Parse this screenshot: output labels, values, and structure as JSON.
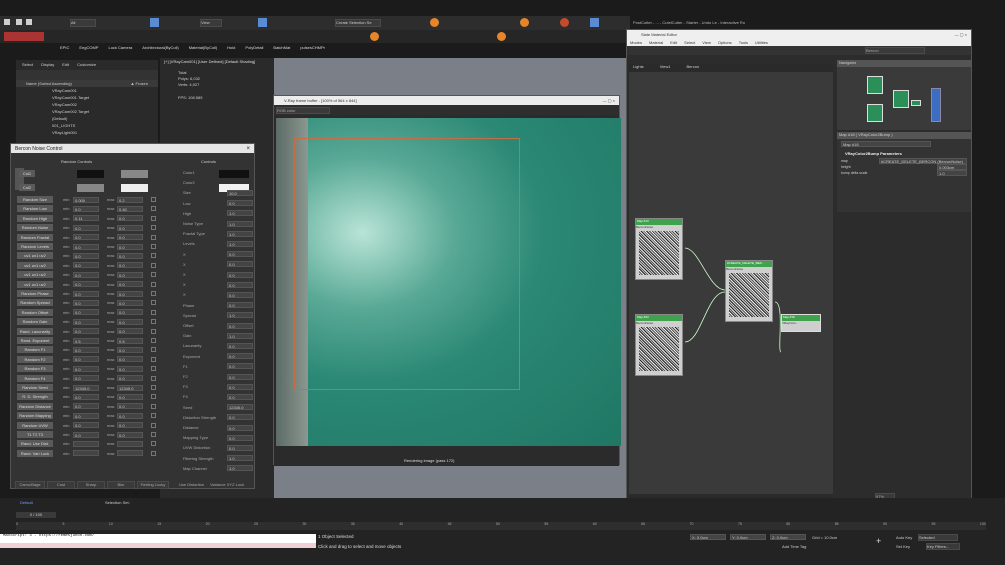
{
  "max": {
    "toolbar_dropdown": "All",
    "view_dropdown": "View",
    "selection_set": "Create Selection Se",
    "shelf": [
      "EPIC",
      "EngCOMP",
      "Lock Camera",
      "Architectural(ByColl)",
      "Material(ByColl)",
      "Hold",
      "PolyDetail",
      "BatchMat",
      "pulsesCHMPr"
    ],
    "scene_explorer": {
      "menu": [
        "Select",
        "Display",
        "Edit",
        "Customize"
      ],
      "header": "Name (Sorted Ascending)",
      "frozen_header": "▲ Frozen",
      "items": [
        "VRayCam001",
        "VRayCam001.Target",
        "VRayCam002",
        "VRayCam002.Target",
        "(Default)",
        "001_LIGHTS",
        "VRayLight001"
      ]
    },
    "viewport": {
      "label": "[+] [VRayCam001] [User Defined] [Default Shading]",
      "stats": [
        "Total",
        "Polys: 6,032",
        "Verts: 4,927"
      ],
      "fps": "FPS: 108.585"
    },
    "status": {
      "selected": "1 Object Selected",
      "hint": "Click and drag to select and move objects",
      "frame": "0 / 100",
      "workspace": "Default",
      "selection_set": "Selection Set:",
      "grid": "Grid = 10.0cm",
      "x": "X: 0.0cm",
      "y": "Y: 0.0cm",
      "z": "Z: 0.0cm",
      "add_time_tag": "Add Time Tag",
      "autokey": "Auto Key",
      "selected_dropdown": "Selected",
      "setkey": "Set Key",
      "keyfilters": "Key Filters...",
      "timeline_ticks": [
        "0",
        "5",
        "10",
        "15",
        "20",
        "25",
        "30",
        "35",
        "40",
        "45",
        "50",
        "55",
        "60",
        "65",
        "70",
        "75",
        "80",
        "85",
        "90",
        "95",
        "100"
      ]
    },
    "script": "MaxScript: 3 - https://remesjunon.com/"
  },
  "bercon": {
    "title": "Bercon Noise Control",
    "random_header": "Random Controls",
    "controls_header": "Controls",
    "color_labels": [
      "Col1",
      "Col2"
    ],
    "left_rows": [
      "Random Size",
      "Random Low",
      "Random High",
      "Random Noise",
      "Random Fractal",
      "Random Levels",
      "uv1 uv1 uv2",
      "uv1 uv1 uv2",
      "uv1 uv1 uv2",
      "uv1 uv1 uv2",
      "Random Phase",
      "Random Spread",
      "Random Offset",
      "Random Gain",
      "Rand. Lacunarity",
      "Rand. Exponent",
      "Random F1",
      "Random F2",
      "Random F3",
      "Random F4",
      "Random Seed",
      "R. D. Strength",
      "Random Distance",
      "Random Mapping",
      "Random UVW",
      "T1 T2 T3",
      "Rand. Use Dist.",
      "Rand. Vari Lock"
    ],
    "min_values": [
      "0.000",
      "0.0",
      "0.11",
      "0.0",
      "0.0",
      "0.0",
      "0.0",
      "0.0",
      "0.0",
      "0.0",
      "0.0",
      "0.0",
      "0.0",
      "0.0",
      "0.0",
      "0.5",
      "0.0",
      "0.0",
      "0.0",
      "0.0",
      "12345.0",
      "0.0",
      "0.0",
      "0.0",
      "0.0",
      "0.0",
      "",
      ""
    ],
    "max_values": [
      "0.2",
      "0.40",
      "0.0",
      "0.0",
      "0.0",
      "0.0",
      "0.0",
      "0.0",
      "0.0",
      "0.0",
      "0.0",
      "0.0",
      "0.0",
      "0.0",
      "0.0",
      "0.5",
      "0.0",
      "0.0",
      "0.0",
      "0.0",
      "12345.0",
      "0.0",
      "0.0",
      "0.0",
      "0.0",
      "0.0",
      "",
      ""
    ],
    "right_rows": [
      "Color1",
      "Color2",
      "Size",
      "Low",
      "High",
      "Noise Type",
      "Fractal Type",
      "Levels",
      "X",
      "X",
      "X",
      "X",
      "X",
      "Phase",
      "Spread",
      "Offset",
      "Gain",
      "Lacunarity",
      "Exponent",
      "F1",
      "F2",
      "F3",
      "F4",
      "Seed",
      "Distortion Strength",
      "Distance",
      "Mapping Type",
      "UVW Distortion",
      "Filtering Strength",
      "Map Channel"
    ],
    "right_values": [
      "",
      "",
      "10.0",
      "0.0",
      "1.0",
      "1.0",
      "1.0",
      "1.0",
      "0.0",
      "0.0",
      "0.0",
      "0.0",
      "0.0",
      "0.0",
      "1.0",
      "0.0",
      "1.0",
      "0.0",
      "0.0",
      "0.0",
      "0.0",
      "0.0",
      "0.0",
      "12345.0",
      "0.0",
      "0.0",
      "0.0",
      "0.0",
      "1.0",
      "1.0"
    ],
    "bottom_buttons": [
      "Camo/Bage",
      "Cust",
      "Sharp",
      "Blur",
      "Feeling Lucky"
    ],
    "bottom_checks": [
      "Use Distortion",
      "Variance XYZ Lock"
    ]
  },
  "vfb": {
    "title": "V-Ray frame buffer - [100% of 564 x 844]",
    "channel": "RGB color",
    "status": "Rendering image (pass 172)"
  },
  "sme": {
    "title": "Slate Material Editor",
    "topbar": "PostCutter - ... - CutelCutter - Starter - Undo Le - Interactive Ro",
    "menu": [
      "Modes",
      "Material",
      "Edit",
      "Select",
      "View",
      "Options",
      "Tools",
      "Utilities"
    ],
    "view_tabs": [
      "Lights",
      "View1",
      "Bercon"
    ],
    "dropdown": "Bercon",
    "navigator": "Navigator",
    "params_title": "Map #18 ( VRayColor2Bump )",
    "params_name": "Map #18",
    "rollout": "VRayColor2Bump Parameters",
    "params": [
      {
        "label": "map",
        "value": "#CREATE_DELETE_BERCON (BerconNoise)"
      },
      {
        "label": "height",
        "value": "0.003cm"
      },
      {
        "label": "bump delta scale",
        "value": "1.0"
      }
    ],
    "nodes": [
      {
        "title": "Map #13",
        "sub": "BerconNoise"
      },
      {
        "title": "Map #23",
        "sub": "BerconNoise"
      },
      {
        "title": "#CREATE_DELETE_BER...",
        "sub": "BerconNoise"
      },
      {
        "title": "Map #18",
        "sub": "VRayColo..."
      }
    ],
    "status": "Rendering finished",
    "zoom": "97%"
  }
}
